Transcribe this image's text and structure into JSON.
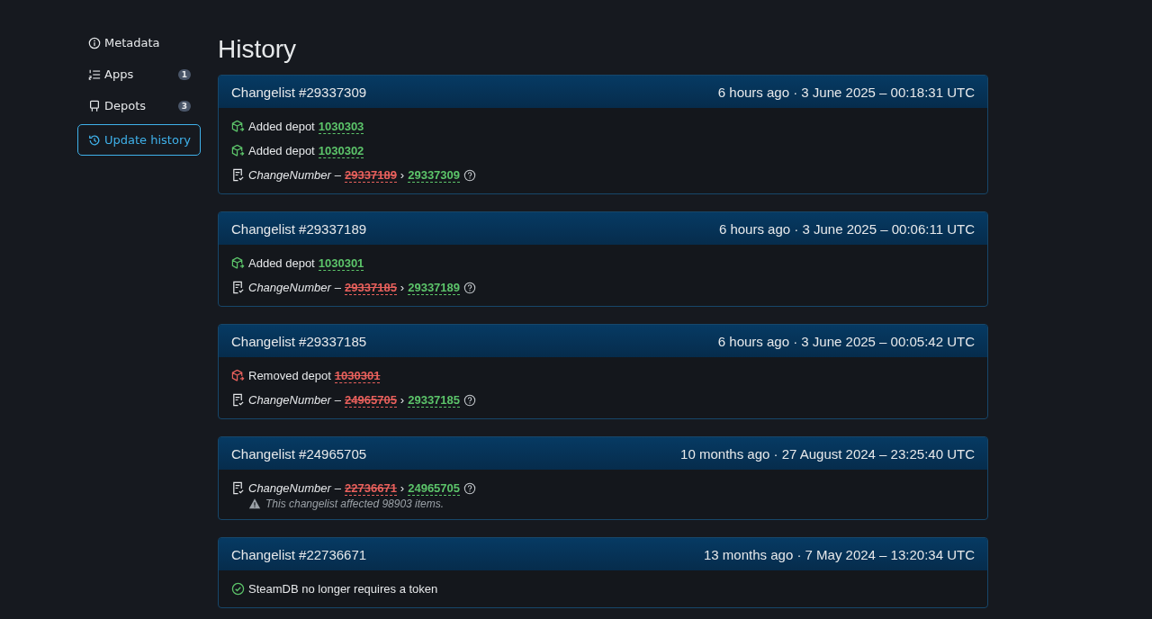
{
  "sidebar": {
    "items": [
      {
        "kind": "info",
        "label": "Metadata",
        "selected": false
      },
      {
        "kind": "list",
        "label": "Apps",
        "badge": "1",
        "selected": false
      },
      {
        "kind": "depot",
        "label": "Depots",
        "badge": "3",
        "selected": false
      },
      {
        "kind": "history",
        "label": "Update history",
        "selected": true
      }
    ]
  },
  "heading": "History",
  "changelists": [
    {
      "title": "Changelist #29337309",
      "time": "6 hours ago · 3 June 2025 – 00:18:31 UTC",
      "entries": [
        {
          "kind": "added",
          "label": "Added depot",
          "value": "1030303"
        },
        {
          "kind": "added",
          "label": "Added depot",
          "value": "1030302"
        },
        {
          "kind": "change",
          "key": "ChangeNumber",
          "separator": "–",
          "old": "29337189",
          "arrow": "›",
          "new": "29337309"
        }
      ]
    },
    {
      "title": "Changelist #29337189",
      "time": "6 hours ago · 3 June 2025 – 00:06:11 UTC",
      "entries": [
        {
          "kind": "added",
          "label": "Added depot",
          "value": "1030301"
        },
        {
          "kind": "change",
          "key": "ChangeNumber",
          "separator": "–",
          "old": "29337185",
          "arrow": "›",
          "new": "29337189"
        }
      ]
    },
    {
      "title": "Changelist #29337185",
      "time": "6 hours ago · 3 June 2025 – 00:05:42 UTC",
      "entries": [
        {
          "kind": "removed",
          "label": "Removed depot",
          "value": "1030301"
        },
        {
          "kind": "change",
          "key": "ChangeNumber",
          "separator": "–",
          "old": "24965705",
          "arrow": "›",
          "new": "29337185"
        }
      ]
    },
    {
      "title": "Changelist #24965705",
      "time": "10 months ago · 27 August 2024 – 23:25:40 UTC",
      "entries": [
        {
          "kind": "change",
          "key": "ChangeNumber",
          "separator": "–",
          "old": "22736671",
          "arrow": "›",
          "new": "24965705",
          "warning": "This changelist affected 98903 items."
        }
      ]
    },
    {
      "title": "Changelist #22736671",
      "time": "13 months ago · 7 May 2024 – 13:20:34 UTC",
      "entries": [
        {
          "kind": "notice",
          "text": "SteamDB no longer requires a token"
        }
      ]
    }
  ]
}
